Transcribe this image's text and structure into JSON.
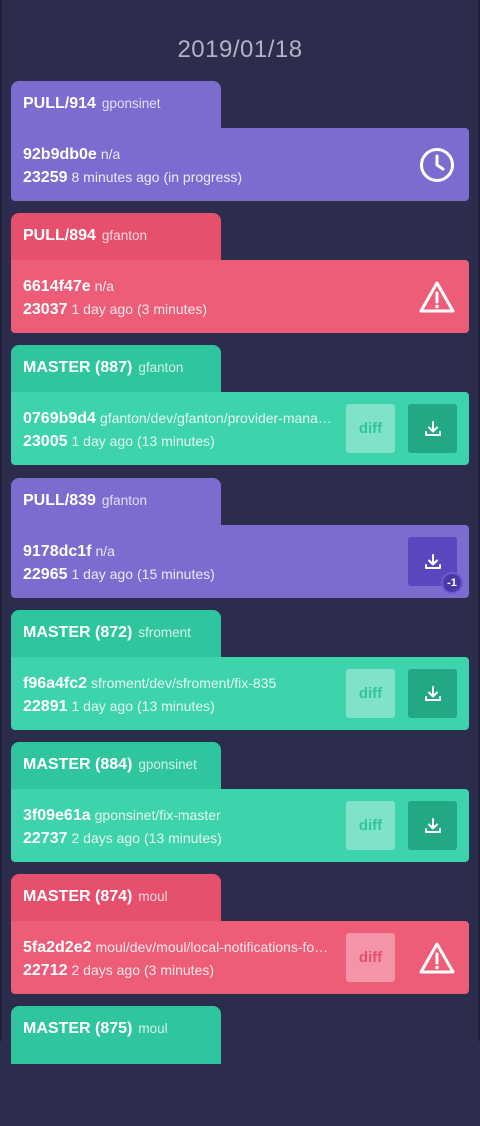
{
  "date_heading": "2019/01/18",
  "builds": [
    {
      "title": "PULL/914",
      "author": "gponsinet",
      "hash": "92b9db0e",
      "branch": "n/a",
      "number": "23259",
      "when": "8 minutes ago",
      "duration": "(in progress)",
      "status": "in-progress",
      "color": "purple",
      "has_diff": false,
      "has_download": false
    },
    {
      "title": "PULL/894",
      "author": "gfanton",
      "hash": "6614f47e",
      "branch": "n/a",
      "number": "23037",
      "when": "1 day ago",
      "duration": "(3 minutes)",
      "status": "failed",
      "color": "red",
      "has_diff": false,
      "has_download": false
    },
    {
      "title": "MASTER (887)",
      "author": "gfanton",
      "hash": "0769b9d4",
      "branch": "gfanton/dev/gfanton/provider-manager",
      "number": "23005",
      "when": "1 day ago",
      "duration": "(13 minutes)",
      "status": "success",
      "color": "green",
      "has_diff": true,
      "has_download": true
    },
    {
      "title": "PULL/839",
      "author": "gfanton",
      "hash": "9178dc1f",
      "branch": "n/a",
      "number": "22965",
      "when": "1 day ago",
      "duration": "(15 minutes)",
      "status": "success",
      "color": "purple",
      "has_diff": false,
      "has_download": true,
      "badge": "-1"
    },
    {
      "title": "MASTER (872)",
      "author": "sfroment",
      "hash": "f96a4fc2",
      "branch": "sfroment/dev/sfroment/fix-835",
      "number": "22891",
      "when": "1 day ago",
      "duration": "(13 minutes)",
      "status": "success",
      "color": "green",
      "has_diff": true,
      "has_download": true
    },
    {
      "title": "MASTER (884)",
      "author": "gponsinet",
      "hash": "3f09e61a",
      "branch": "gponsinet/fix-master",
      "number": "22737",
      "when": "2 days ago",
      "duration": "(13 minutes)",
      "status": "success",
      "color": "green",
      "has_diff": true,
      "has_download": true
    },
    {
      "title": "MASTER (874)",
      "author": "moul",
      "hash": "5fa2d2e2",
      "branch": "moul/dev/moul/local-notifications-for-...",
      "number": "22712",
      "when": "2 days ago",
      "duration": "(3 minutes)",
      "status": "failed",
      "color": "red",
      "has_diff": true,
      "has_download": false
    },
    {
      "title": "MASTER (875)",
      "author": "moul",
      "hash": "",
      "branch": "",
      "number": "",
      "when": "",
      "duration": "",
      "status": "",
      "color": "green",
      "has_diff": false,
      "has_download": false
    }
  ],
  "diff_label": "diff",
  "icons": {
    "in_progress": "clock-icon",
    "failed": "warning-icon",
    "download": "download-icon"
  }
}
